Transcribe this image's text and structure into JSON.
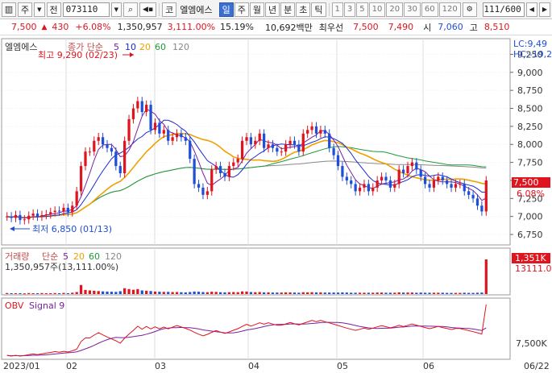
{
  "toolbar": {
    "mode1": "주",
    "mode2": "전",
    "code": "073110",
    "market_tag": "코",
    "name": "엘엠에스",
    "periods": [
      "일",
      "주",
      "월",
      "년",
      "분",
      "초",
      "틱"
    ],
    "active_period": "일",
    "intervals": [
      "1",
      "3",
      "5",
      "10",
      "20",
      "30",
      "60",
      "120"
    ],
    "count": "111/600"
  },
  "quote": {
    "price": "7,500",
    "change": "430",
    "change_pct": "+6.08%",
    "volume": "1,350,957",
    "volume_pct": "3,111.00%",
    "turnover": "15.19%",
    "amount": "10,692백만",
    "label_best": "최우선",
    "ask": "7,500",
    "bid": "7,490",
    "open_label": "시",
    "open": "7,060",
    "high_label": "고",
    "high": "8,510"
  },
  "price_panel": {
    "name": "엘엠에스",
    "ma_label": "종가 단순",
    "ma_periods": [
      "5",
      "10",
      "20",
      "60",
      "120"
    ],
    "max_label": "최고 9,290 (02/23)",
    "min_label": "최저 6,850 (01/13)",
    "lc": "LC:9,49",
    "hc": "HC:-19,2",
    "price_tag": "7,500",
    "pct_tag": "6.08%",
    "y_ticks": [
      "9,250",
      "9,000",
      "8,750",
      "8,500",
      "8,250",
      "8,000",
      "7,750",
      "7,500",
      "7,250",
      "7,000",
      "6,750"
    ]
  },
  "volume_panel": {
    "label": "거래량",
    "ma_label": "단순",
    "ma_periods": [
      "5",
      "20",
      "60",
      "120"
    ],
    "info": "1,350,957주(13,111.00%)",
    "tag": "1,351K",
    "tag2": "13111.0"
  },
  "obv_panel": {
    "label": "OBV",
    "signal": "Signal 9",
    "y_tick": "7,500K"
  },
  "x_axis": {
    "labels": [
      "2023/01",
      "02",
      "03",
      "04",
      "05",
      "06",
      "06/22"
    ]
  },
  "colors": {
    "up": "#e0141e",
    "down": "#1f4fd6",
    "ma5": "#7a1fa2",
    "ma10": "#1a2bd0",
    "ma20": "#f0a000",
    "ma60": "#1e9a3a",
    "ma120": "#888888"
  },
  "chart_data": {
    "type": "candlestick",
    "y_range": [
      6650,
      9400
    ],
    "closes": [
      7000,
      6980,
      7020,
      6950,
      6960,
      7010,
      7040,
      7000,
      7020,
      7030,
      7060,
      7080,
      7070,
      7120,
      7060,
      7150,
      7350,
      7700,
      7900,
      7900,
      8050,
      8100,
      8000,
      7950,
      7900,
      7700,
      7600,
      8050,
      8350,
      8500,
      8600,
      8450,
      8550,
      8200,
      8300,
      8150,
      8200,
      8050,
      8100,
      8150,
      8100,
      8050,
      7800,
      7450,
      7400,
      7300,
      7350,
      7650,
      7700,
      7600,
      7550,
      7700,
      7750,
      7800,
      8050,
      8100,
      8000,
      8050,
      8150,
      7950,
      8000,
      7950,
      7900,
      7900,
      8000,
      8050,
      8000,
      7900,
      8150,
      8200,
      8250,
      8150,
      8200,
      8150,
      7950,
      7850,
      7700,
      7550,
      7500,
      7450,
      7350,
      7400,
      7450,
      7350,
      7400,
      7500,
      7550,
      7500,
      7400,
      7450,
      7650,
      7600,
      7700,
      7750,
      7650,
      7550,
      7450,
      7400,
      7500,
      7550,
      7500,
      7450,
      7400,
      7450,
      7450,
      7350,
      7300,
      7250,
      7150,
      7070,
      7500
    ],
    "volumes": [
      6,
      5,
      5,
      5,
      4,
      6,
      5,
      5,
      6,
      5,
      5,
      6,
      5,
      7,
      5,
      8,
      12,
      55,
      25,
      22,
      20,
      18,
      16,
      15,
      14,
      13,
      17,
      35,
      30,
      26,
      30,
      22,
      20,
      18,
      15,
      14,
      13,
      13,
      12,
      12,
      11,
      10,
      12,
      15,
      14,
      12,
      11,
      14,
      13,
      11,
      10,
      11,
      12,
      11,
      16,
      15,
      12,
      11,
      12,
      10,
      10,
      9,
      9,
      9,
      10,
      10,
      9,
      8,
      11,
      10,
      11,
      10,
      10,
      9,
      9,
      9,
      9,
      10,
      9,
      8,
      8,
      8,
      8,
      8,
      8,
      9,
      9,
      8,
      8,
      8,
      10,
      9,
      9,
      9,
      8,
      9,
      8,
      8,
      8,
      8,
      8,
      7,
      7,
      7,
      7,
      8,
      7,
      7,
      8,
      9,
      210
    ]
  }
}
